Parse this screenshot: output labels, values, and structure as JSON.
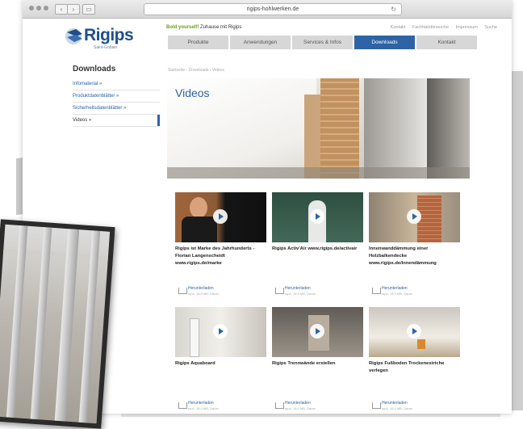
{
  "browser": {
    "url": "rigips-hohlwerken.de"
  },
  "site": {
    "logo": {
      "name": "Rigips",
      "tagline": "Saint-Gobain"
    },
    "slogan_green": "Bold yourself!",
    "slogan_rest": "Zuhause mit Rigips",
    "util_links": [
      "Kontakt",
      "Fachhändlersuche",
      "Impressum",
      "Suche"
    ],
    "nav": [
      "Produkte",
      "Anwendungen",
      "Services & Infos",
      "Downloads",
      "Kontakt"
    ],
    "nav_active": "Downloads"
  },
  "sidebar": {
    "title": "Downloads",
    "items": [
      {
        "label": "Infomaterial »"
      },
      {
        "label": "Produktdatenblätter »"
      },
      {
        "label": "Sicherheitsdatenblätter »"
      },
      {
        "label": "Videos »"
      }
    ]
  },
  "breadcrumb": "Startseite  ›  Downloads  ›  Videos",
  "hero": {
    "title": "Videos"
  },
  "videos": [
    {
      "title": "Rigips ist Marke des Jahrhunderts - Florian Langenscheidt www.rigips.de/marke",
      "download": "Herunterladen",
      "meta": "mp4, 18,0 MB, Dauer"
    },
    {
      "title": "Rigips Activ'Air www.rigips.de/activair",
      "download": "Herunterladen",
      "meta": "mp4, 18,0 MB, Dauer"
    },
    {
      "title": "Innenwanddämmung einer Holzbalkendecke www.rigips.de/innendämmung",
      "download": "Herunterladen",
      "meta": "mp4, 18,0 MB, Dauer"
    },
    {
      "title": "Rigips Aquaboard",
      "download": "Herunterladen",
      "meta": "mp4, 18,0 MB, Dauer"
    },
    {
      "title": "Rigips Trennwände erstellen",
      "download": "Herunterladen",
      "meta": "mp4, 18,0 MB, Dauer"
    },
    {
      "title": "Rigips Fußboden Trockenestriche verlegen",
      "download": "Herunterladen",
      "meta": "mp4, 18,0 MB, Dauer"
    }
  ]
}
